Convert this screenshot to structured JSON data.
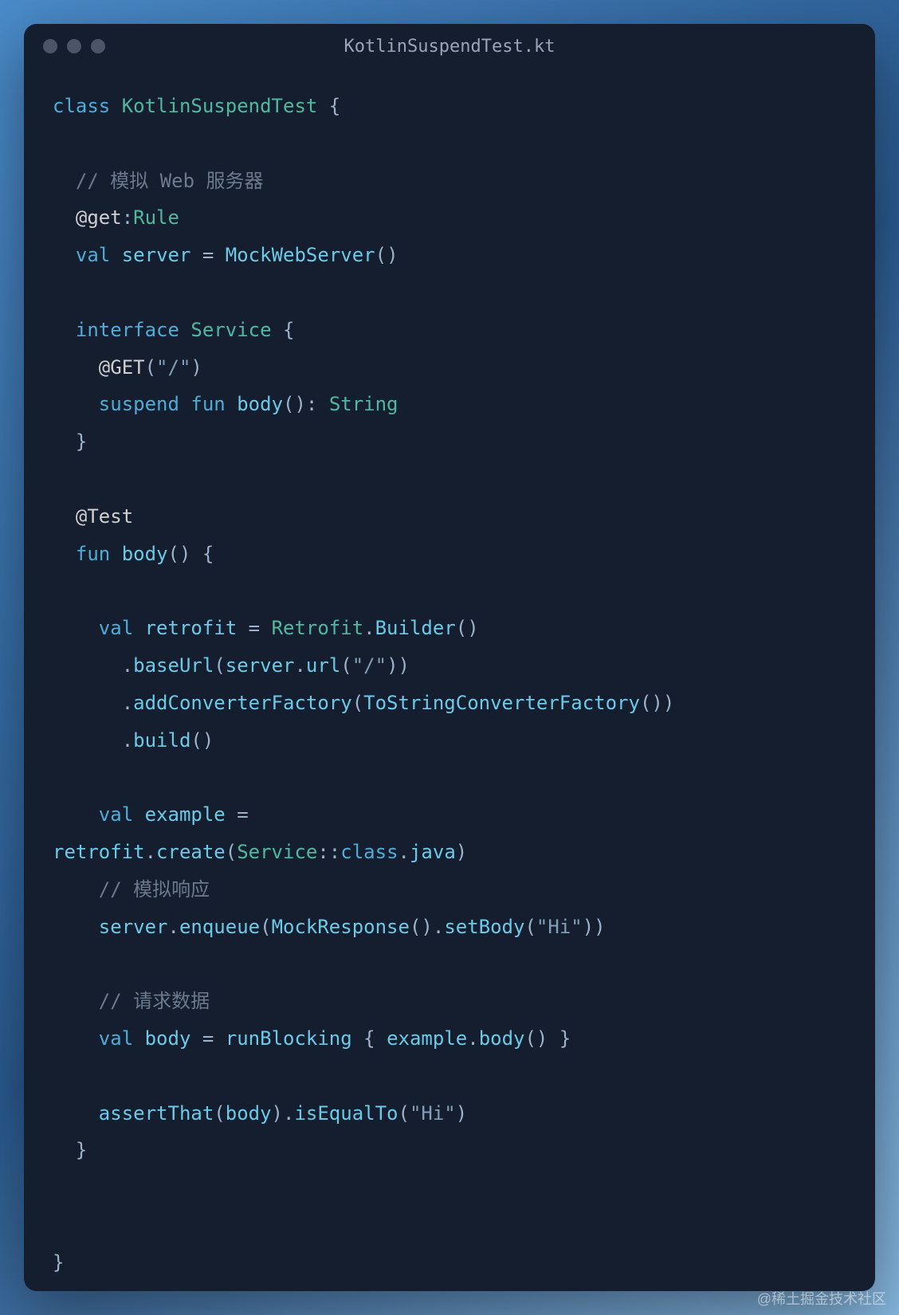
{
  "window": {
    "title": "KotlinSuspendTest.kt"
  },
  "code": {
    "tokens": [
      {
        "text": "class",
        "cls": "keyword"
      },
      {
        "text": " ",
        "cls": ""
      },
      {
        "text": "KotlinSuspendTest",
        "cls": "type"
      },
      {
        "text": " {",
        "cls": "punct"
      },
      {
        "text": "\n",
        "cls": ""
      },
      {
        "text": "\n",
        "cls": ""
      },
      {
        "text": "  ",
        "cls": ""
      },
      {
        "text": "// 模拟 Web 服务器",
        "cls": "comment"
      },
      {
        "text": "\n",
        "cls": ""
      },
      {
        "text": "  ",
        "cls": ""
      },
      {
        "text": "@get",
        "cls": "annotation"
      },
      {
        "text": ":",
        "cls": "punct"
      },
      {
        "text": "Rule",
        "cls": "type"
      },
      {
        "text": "\n",
        "cls": ""
      },
      {
        "text": "  ",
        "cls": ""
      },
      {
        "text": "val",
        "cls": "keyword"
      },
      {
        "text": " ",
        "cls": ""
      },
      {
        "text": "server",
        "cls": "ident"
      },
      {
        "text": " = ",
        "cls": "punct"
      },
      {
        "text": "MockWebServer",
        "cls": "method"
      },
      {
        "text": "()",
        "cls": "punct"
      },
      {
        "text": "\n",
        "cls": ""
      },
      {
        "text": "\n",
        "cls": ""
      },
      {
        "text": "  ",
        "cls": ""
      },
      {
        "text": "interface",
        "cls": "keyword"
      },
      {
        "text": " ",
        "cls": ""
      },
      {
        "text": "Service",
        "cls": "type"
      },
      {
        "text": " {",
        "cls": "punct"
      },
      {
        "text": "\n",
        "cls": ""
      },
      {
        "text": "    ",
        "cls": ""
      },
      {
        "text": "@GET",
        "cls": "annotation"
      },
      {
        "text": "(",
        "cls": "punct"
      },
      {
        "text": "\"/\"",
        "cls": "string"
      },
      {
        "text": ")",
        "cls": "punct"
      },
      {
        "text": "\n",
        "cls": ""
      },
      {
        "text": "    ",
        "cls": ""
      },
      {
        "text": "suspend",
        "cls": "keyword"
      },
      {
        "text": " ",
        "cls": ""
      },
      {
        "text": "fun",
        "cls": "keyword"
      },
      {
        "text": " ",
        "cls": ""
      },
      {
        "text": "body",
        "cls": "method"
      },
      {
        "text": "(): ",
        "cls": "punct"
      },
      {
        "text": "String",
        "cls": "type"
      },
      {
        "text": "\n",
        "cls": ""
      },
      {
        "text": "  }",
        "cls": "punct"
      },
      {
        "text": "\n",
        "cls": ""
      },
      {
        "text": "\n",
        "cls": ""
      },
      {
        "text": "  ",
        "cls": ""
      },
      {
        "text": "@Test",
        "cls": "annotation"
      },
      {
        "text": "\n",
        "cls": ""
      },
      {
        "text": "  ",
        "cls": ""
      },
      {
        "text": "fun",
        "cls": "keyword"
      },
      {
        "text": " ",
        "cls": ""
      },
      {
        "text": "body",
        "cls": "method"
      },
      {
        "text": "() {",
        "cls": "punct"
      },
      {
        "text": "\n",
        "cls": ""
      },
      {
        "text": "\n",
        "cls": ""
      },
      {
        "text": "    ",
        "cls": ""
      },
      {
        "text": "val",
        "cls": "keyword"
      },
      {
        "text": " ",
        "cls": ""
      },
      {
        "text": "retrofit",
        "cls": "ident"
      },
      {
        "text": " = ",
        "cls": "punct"
      },
      {
        "text": "Retrofit",
        "cls": "type"
      },
      {
        "text": ".",
        "cls": "punct"
      },
      {
        "text": "Builder",
        "cls": "method"
      },
      {
        "text": "()",
        "cls": "punct"
      },
      {
        "text": "\n",
        "cls": ""
      },
      {
        "text": "      .",
        "cls": "punct"
      },
      {
        "text": "baseUrl",
        "cls": "method"
      },
      {
        "text": "(",
        "cls": "punct"
      },
      {
        "text": "server",
        "cls": "ident"
      },
      {
        "text": ".",
        "cls": "punct"
      },
      {
        "text": "url",
        "cls": "method"
      },
      {
        "text": "(",
        "cls": "punct"
      },
      {
        "text": "\"/\"",
        "cls": "string"
      },
      {
        "text": "))",
        "cls": "punct"
      },
      {
        "text": "\n",
        "cls": ""
      },
      {
        "text": "      .",
        "cls": "punct"
      },
      {
        "text": "addConverterFactory",
        "cls": "method"
      },
      {
        "text": "(",
        "cls": "punct"
      },
      {
        "text": "ToStringConverterFactory",
        "cls": "method"
      },
      {
        "text": "())",
        "cls": "punct"
      },
      {
        "text": "\n",
        "cls": ""
      },
      {
        "text": "      .",
        "cls": "punct"
      },
      {
        "text": "build",
        "cls": "method"
      },
      {
        "text": "()",
        "cls": "punct"
      },
      {
        "text": "\n",
        "cls": ""
      },
      {
        "text": "\n",
        "cls": ""
      },
      {
        "text": "    ",
        "cls": ""
      },
      {
        "text": "val",
        "cls": "keyword"
      },
      {
        "text": " ",
        "cls": ""
      },
      {
        "text": "example",
        "cls": "ident"
      },
      {
        "text": " = ",
        "cls": "punct"
      },
      {
        "text": "\n",
        "cls": ""
      },
      {
        "text": "retrofit",
        "cls": "ident"
      },
      {
        "text": ".",
        "cls": "punct"
      },
      {
        "text": "create",
        "cls": "method"
      },
      {
        "text": "(",
        "cls": "punct"
      },
      {
        "text": "Service",
        "cls": "type"
      },
      {
        "text": "::",
        "cls": "punct"
      },
      {
        "text": "class",
        "cls": "keyword"
      },
      {
        "text": ".",
        "cls": "punct"
      },
      {
        "text": "java",
        "cls": "ident"
      },
      {
        "text": ")",
        "cls": "punct"
      },
      {
        "text": "\n",
        "cls": ""
      },
      {
        "text": "    ",
        "cls": ""
      },
      {
        "text": "// 模拟响应",
        "cls": "comment"
      },
      {
        "text": "\n",
        "cls": ""
      },
      {
        "text": "    ",
        "cls": ""
      },
      {
        "text": "server",
        "cls": "ident"
      },
      {
        "text": ".",
        "cls": "punct"
      },
      {
        "text": "enqueue",
        "cls": "method"
      },
      {
        "text": "(",
        "cls": "punct"
      },
      {
        "text": "MockResponse",
        "cls": "method"
      },
      {
        "text": "().",
        "cls": "punct"
      },
      {
        "text": "setBody",
        "cls": "method"
      },
      {
        "text": "(",
        "cls": "punct"
      },
      {
        "text": "\"Hi\"",
        "cls": "string"
      },
      {
        "text": "))",
        "cls": "punct"
      },
      {
        "text": "\n",
        "cls": ""
      },
      {
        "text": "\n",
        "cls": ""
      },
      {
        "text": "    ",
        "cls": ""
      },
      {
        "text": "// 请求数据",
        "cls": "comment"
      },
      {
        "text": "\n",
        "cls": ""
      },
      {
        "text": "    ",
        "cls": ""
      },
      {
        "text": "val",
        "cls": "keyword"
      },
      {
        "text": " ",
        "cls": ""
      },
      {
        "text": "body",
        "cls": "ident"
      },
      {
        "text": " = ",
        "cls": "punct"
      },
      {
        "text": "runBlocking",
        "cls": "method"
      },
      {
        "text": " { ",
        "cls": "punct"
      },
      {
        "text": "example",
        "cls": "ident"
      },
      {
        "text": ".",
        "cls": "punct"
      },
      {
        "text": "body",
        "cls": "method"
      },
      {
        "text": "() }",
        "cls": "punct"
      },
      {
        "text": "\n",
        "cls": ""
      },
      {
        "text": "\n",
        "cls": ""
      },
      {
        "text": "    ",
        "cls": ""
      },
      {
        "text": "assertThat",
        "cls": "method"
      },
      {
        "text": "(",
        "cls": "punct"
      },
      {
        "text": "body",
        "cls": "ident"
      },
      {
        "text": ").",
        "cls": "punct"
      },
      {
        "text": "isEqualTo",
        "cls": "method"
      },
      {
        "text": "(",
        "cls": "punct"
      },
      {
        "text": "\"Hi\"",
        "cls": "string"
      },
      {
        "text": ")",
        "cls": "punct"
      },
      {
        "text": "\n",
        "cls": ""
      },
      {
        "text": "  }",
        "cls": "punct"
      },
      {
        "text": "\n",
        "cls": ""
      },
      {
        "text": "\n",
        "cls": ""
      },
      {
        "text": "\n",
        "cls": ""
      },
      {
        "text": "}",
        "cls": "punct"
      }
    ]
  },
  "watermark": "@稀土掘金技术社区"
}
